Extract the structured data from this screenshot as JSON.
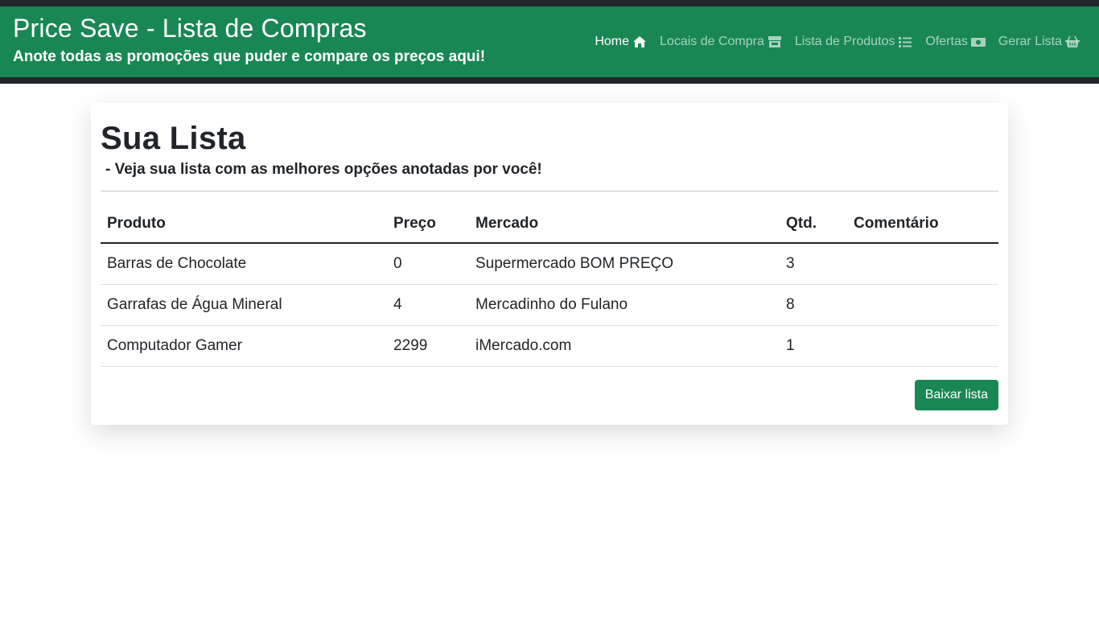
{
  "header": {
    "title": "Price Save - Lista de Compras",
    "subtitle": "Anote todas as promoções que puder e compare os preços aqui!"
  },
  "nav": {
    "items": [
      {
        "label": "Home",
        "icon": "home-icon",
        "active": true
      },
      {
        "label": "Locais de Compra",
        "icon": "store-icon",
        "active": false
      },
      {
        "label": "Lista de Produtos",
        "icon": "list-icon",
        "active": false
      },
      {
        "label": "Ofertas",
        "icon": "money-icon",
        "active": false
      },
      {
        "label": "Gerar Lista",
        "icon": "basket-icon",
        "active": false
      }
    ]
  },
  "main": {
    "title": "Sua Lista",
    "subtitle": "- Veja sua lista com as melhores opções anotadas por você!",
    "table": {
      "headers": [
        "Produto",
        "Preço",
        "Mercado",
        "Qtd.",
        "Comentário"
      ],
      "rows": [
        [
          "Barras de Chocolate",
          "0",
          "Supermercado BOM PREÇO",
          "3",
          ""
        ],
        [
          "Garrafas de Água Mineral",
          "4",
          "Mercadinho do Fulano",
          "8",
          ""
        ],
        [
          "Computador Gamer",
          "2299",
          "iMercado.com",
          "1",
          ""
        ]
      ]
    },
    "download_label": "Baixar lista"
  },
  "colors": {
    "brand": "#198754",
    "dark": "#212529"
  }
}
